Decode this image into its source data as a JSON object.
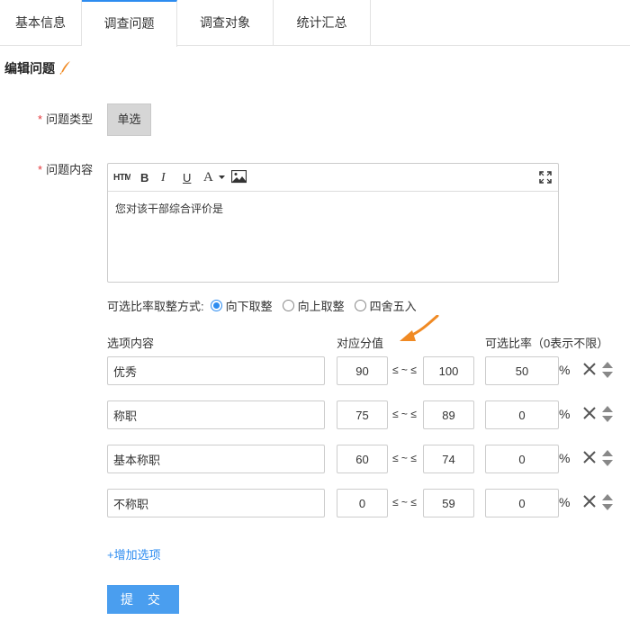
{
  "tabs": [
    {
      "label": "基本信息",
      "active": false
    },
    {
      "label": "调查问题",
      "active": true
    },
    {
      "label": "调查对象",
      "active": false
    },
    {
      "label": "统计汇总",
      "active": false
    }
  ],
  "section_title": "编辑问题",
  "form": {
    "required_mark": "*",
    "type_label": "问题类型",
    "type_value": "单选",
    "content_label": "问题内容",
    "content_text": "您对该干部综合评价是"
  },
  "toolbar": {
    "html": "HTML",
    "bold": "B",
    "italic": "I",
    "underline": "U",
    "font_color": "A"
  },
  "rounding": {
    "label": "可选比率取整方式:",
    "options": [
      "向下取整",
      "向上取整",
      "四舍五入"
    ],
    "selected": "向下取整"
  },
  "columns": {
    "option_content": "选项内容",
    "score": "对应分值",
    "ratio": "可选比率（0表示不限）"
  },
  "range_sep": "≤ ~ ≤",
  "percent": "%",
  "rows": [
    {
      "content": "优秀",
      "min": "90",
      "max": "100",
      "ratio": "50"
    },
    {
      "content": "称职",
      "min": "75",
      "max": "89",
      "ratio": "0"
    },
    {
      "content": "基本称职",
      "min": "60",
      "max": "74",
      "ratio": "0"
    },
    {
      "content": "不称职",
      "min": "0",
      "max": "59",
      "ratio": "0"
    }
  ],
  "add_option": "+增加选项",
  "submit": "提 交",
  "colors": {
    "accent": "#2d8cf0",
    "submit_bg": "#4a9eef",
    "pen": "#f08a24",
    "arrow": "#f08a24"
  }
}
